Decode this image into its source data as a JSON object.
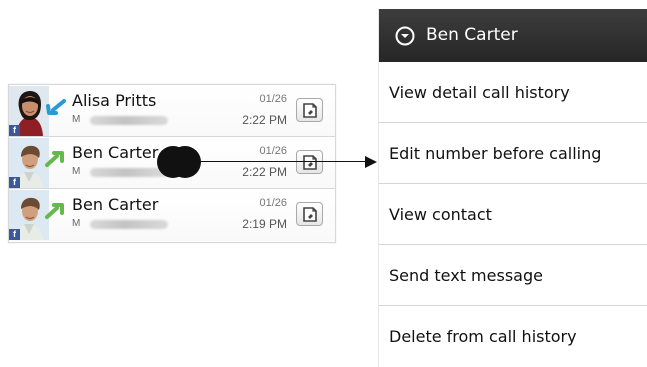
{
  "call_log": {
    "rows": [
      {
        "name": "Alisa Pritts",
        "number_type": "M",
        "date": "01/26",
        "time": "2:22 PM",
        "avatar": "female-contact-photo",
        "source_icon": "facebook-icon",
        "call_type_icon": "incoming-call-icon",
        "action_icon": "message-icon"
      },
      {
        "name": "Ben Carter",
        "number_type": "M",
        "date": "01/26",
        "time": "2:22 PM",
        "avatar": "male-contact-photo",
        "source_icon": "facebook-icon",
        "call_type_icon": "outgoing-call-icon",
        "action_icon": "message-icon"
      },
      {
        "name": "Ben Carter",
        "number_type": "M",
        "date": "01/26",
        "time": "2:19 PM",
        "avatar": "male-contact-photo",
        "source_icon": "facebook-icon",
        "call_type_icon": "outgoing-call-icon",
        "action_icon": "message-icon"
      }
    ]
  },
  "gesture": {
    "icon": "touch-point-icon",
    "pointer": "arrow-right-icon"
  },
  "context_menu": {
    "title": "Ben Carter",
    "header_icon": "chevron-down-circle-icon",
    "items": [
      {
        "label": "View detail call history"
      },
      {
        "label": "Edit number before calling"
      },
      {
        "label": "View contact"
      },
      {
        "label": "Send text message"
      },
      {
        "label": "Delete from call history"
      }
    ]
  },
  "colors": {
    "header_background": "#2f2f2f",
    "facebook_blue": "#3b5998",
    "call_arrow_blue": "#2a9ad7",
    "call_arrow_green": "#65b94c"
  }
}
